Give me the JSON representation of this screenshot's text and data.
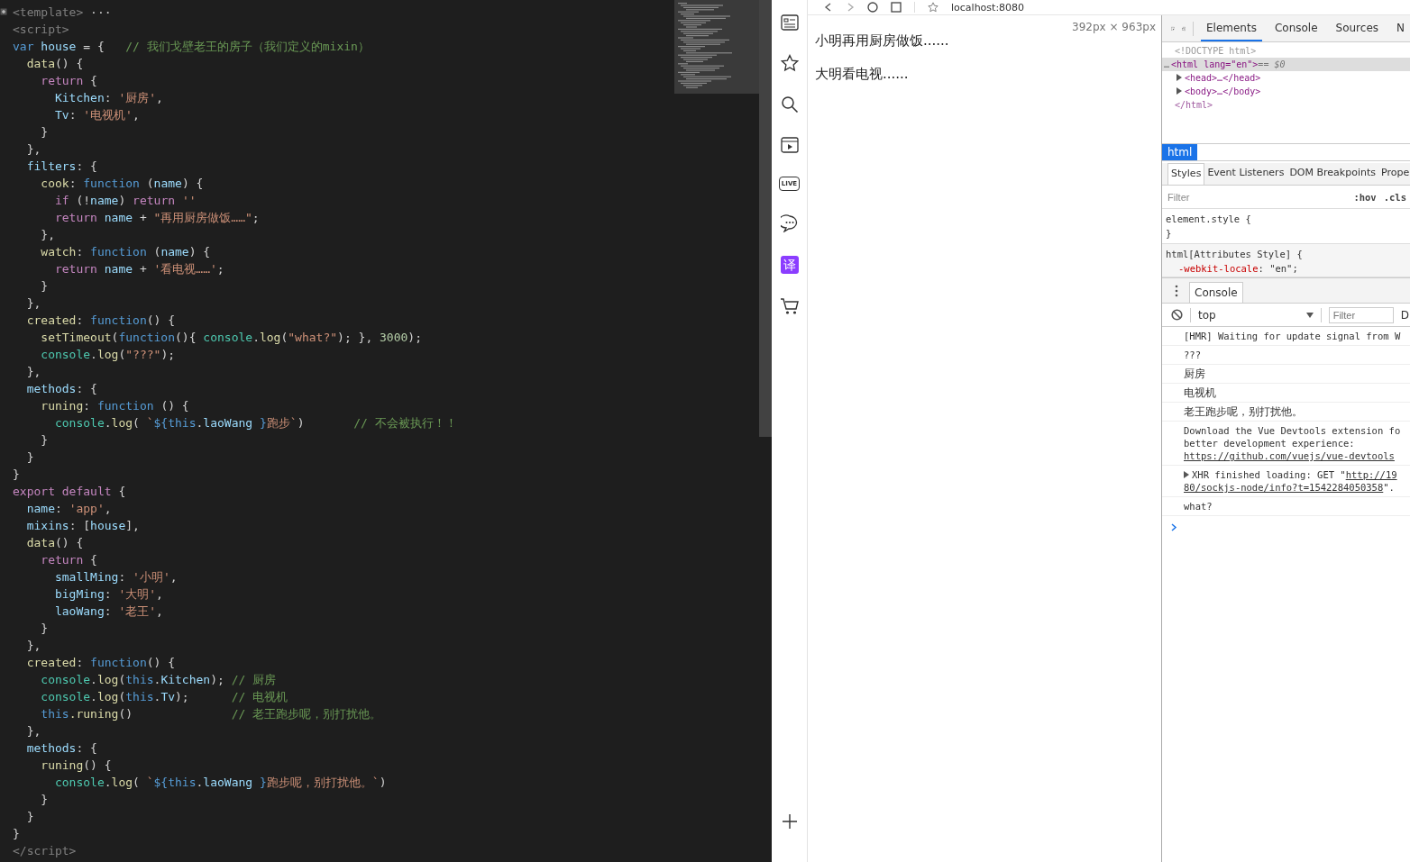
{
  "editor": {
    "lines": [
      {
        "tokens": [
          {
            "kind": "tag",
            "text": "<template>"
          },
          {
            "kind": "plain",
            "text": " ···"
          }
        ]
      },
      {
        "tokens": [
          {
            "kind": "tag",
            "text": "<script>"
          }
        ]
      },
      {
        "tokens": [
          {
            "kind": "storage",
            "text": "var "
          },
          {
            "kind": "variable",
            "text": "house"
          },
          {
            "kind": "plain",
            "text": " = {   "
          },
          {
            "kind": "comment",
            "text": "// 我们戈壁老王的房子（我们定义的mixin）"
          }
        ]
      },
      {
        "tokens": [
          {
            "kind": "function",
            "text": "  data"
          },
          {
            "kind": "plain",
            "text": "() {"
          }
        ]
      },
      {
        "tokens": [
          {
            "kind": "keyword",
            "text": "    return"
          },
          {
            "kind": "plain",
            "text": " {"
          }
        ]
      },
      {
        "tokens": [
          {
            "kind": "variable",
            "text": "      Kitchen"
          },
          {
            "kind": "plain",
            "text": ": "
          },
          {
            "kind": "string",
            "text": "'厨房'"
          },
          {
            "kind": "plain",
            "text": ","
          }
        ]
      },
      {
        "tokens": [
          {
            "kind": "variable",
            "text": "      Tv"
          },
          {
            "kind": "plain",
            "text": ": "
          },
          {
            "kind": "string",
            "text": "'电视机'"
          },
          {
            "kind": "plain",
            "text": ","
          }
        ]
      },
      {
        "tokens": [
          {
            "kind": "plain",
            "text": "    }"
          }
        ]
      },
      {
        "tokens": [
          {
            "kind": "plain",
            "text": "  },"
          }
        ]
      },
      {
        "tokens": [
          {
            "kind": "variable",
            "text": "  filters"
          },
          {
            "kind": "plain",
            "text": ": {"
          }
        ]
      },
      {
        "tokens": [
          {
            "kind": "function",
            "text": "    cook"
          },
          {
            "kind": "plain",
            "text": ": "
          },
          {
            "kind": "storage",
            "text": "function"
          },
          {
            "kind": "plain",
            "text": " ("
          },
          {
            "kind": "variable",
            "text": "name"
          },
          {
            "kind": "plain",
            "text": ") {"
          }
        ]
      },
      {
        "tokens": [
          {
            "kind": "keyword",
            "text": "      if"
          },
          {
            "kind": "plain",
            "text": " (!"
          },
          {
            "kind": "variable",
            "text": "name"
          },
          {
            "kind": "plain",
            "text": ") "
          },
          {
            "kind": "keyword",
            "text": "return "
          },
          {
            "kind": "string",
            "text": "''"
          }
        ]
      },
      {
        "tokens": [
          {
            "kind": "keyword",
            "text": "      return "
          },
          {
            "kind": "variable",
            "text": "name"
          },
          {
            "kind": "plain",
            "text": " + "
          },
          {
            "kind": "string",
            "text": "\"再用厨房做饭……\""
          },
          {
            "kind": "plain",
            "text": ";"
          }
        ]
      },
      {
        "tokens": [
          {
            "kind": "plain",
            "text": "    },"
          }
        ]
      },
      {
        "tokens": [
          {
            "kind": "function",
            "text": "    watch"
          },
          {
            "kind": "plain",
            "text": ": "
          },
          {
            "kind": "storage",
            "text": "function"
          },
          {
            "kind": "plain",
            "text": " ("
          },
          {
            "kind": "variable",
            "text": "name"
          },
          {
            "kind": "plain",
            "text": ") {"
          }
        ]
      },
      {
        "tokens": [
          {
            "kind": "keyword",
            "text": "      return "
          },
          {
            "kind": "variable",
            "text": "name"
          },
          {
            "kind": "plain",
            "text": " + "
          },
          {
            "kind": "string",
            "text": "'看电视……'"
          },
          {
            "kind": "plain",
            "text": ";"
          }
        ]
      },
      {
        "tokens": [
          {
            "kind": "plain",
            "text": "    }"
          }
        ]
      },
      {
        "tokens": [
          {
            "kind": "plain",
            "text": "  },"
          }
        ]
      },
      {
        "tokens": [
          {
            "kind": "function",
            "text": "  created"
          },
          {
            "kind": "plain",
            "text": ": "
          },
          {
            "kind": "storage",
            "text": "function"
          },
          {
            "kind": "plain",
            "text": "() {"
          }
        ]
      },
      {
        "tokens": [
          {
            "kind": "function",
            "text": "    setTimeout"
          },
          {
            "kind": "plain",
            "text": "("
          },
          {
            "kind": "storage",
            "text": "function"
          },
          {
            "kind": "plain",
            "text": "(){ "
          },
          {
            "kind": "object",
            "text": "console"
          },
          {
            "kind": "plain",
            "text": "."
          },
          {
            "kind": "function",
            "text": "log"
          },
          {
            "kind": "plain",
            "text": "("
          },
          {
            "kind": "string",
            "text": "\"what?\""
          },
          {
            "kind": "plain",
            "text": "); }, "
          },
          {
            "kind": "number",
            "text": "3000"
          },
          {
            "kind": "plain",
            "text": ");"
          }
        ]
      },
      {
        "tokens": [
          {
            "kind": "object",
            "text": "    console"
          },
          {
            "kind": "plain",
            "text": "."
          },
          {
            "kind": "function",
            "text": "log"
          },
          {
            "kind": "plain",
            "text": "("
          },
          {
            "kind": "string",
            "text": "\"???\""
          },
          {
            "kind": "plain",
            "text": ");"
          }
        ]
      },
      {
        "tokens": [
          {
            "kind": "plain",
            "text": "  },"
          }
        ]
      },
      {
        "tokens": [
          {
            "kind": "variable",
            "text": "  methods"
          },
          {
            "kind": "plain",
            "text": ": {"
          }
        ]
      },
      {
        "tokens": [
          {
            "kind": "function",
            "text": "    runing"
          },
          {
            "kind": "plain",
            "text": ": "
          },
          {
            "kind": "storage",
            "text": "function"
          },
          {
            "kind": "plain",
            "text": " () {"
          }
        ]
      },
      {
        "tokens": [
          {
            "kind": "object",
            "text": "      console"
          },
          {
            "kind": "plain",
            "text": "."
          },
          {
            "kind": "function",
            "text": "log"
          },
          {
            "kind": "plain",
            "text": "( "
          },
          {
            "kind": "string",
            "text": "`"
          },
          {
            "kind": "storage",
            "text": "${this"
          },
          {
            "kind": "plain",
            "text": "."
          },
          {
            "kind": "variable",
            "text": "laoWang"
          },
          {
            "kind": "storage",
            "text": " }"
          },
          {
            "kind": "string",
            "text": "跑步`"
          },
          {
            "kind": "plain",
            "text": ")       "
          },
          {
            "kind": "comment",
            "text": "// 不会被执行！！"
          }
        ]
      },
      {
        "tokens": [
          {
            "kind": "plain",
            "text": "    }"
          }
        ]
      },
      {
        "tokens": [
          {
            "kind": "plain",
            "text": "  }"
          }
        ]
      },
      {
        "tokens": [
          {
            "kind": "plain",
            "text": "}"
          }
        ]
      },
      {
        "tokens": [
          {
            "kind": "keyword",
            "text": "export default"
          },
          {
            "kind": "plain",
            "text": " {"
          }
        ]
      },
      {
        "tokens": [
          {
            "kind": "variable",
            "text": "  name"
          },
          {
            "kind": "plain",
            "text": ": "
          },
          {
            "kind": "string",
            "text": "'app'"
          },
          {
            "kind": "plain",
            "text": ","
          }
        ]
      },
      {
        "tokens": [
          {
            "kind": "variable",
            "text": "  mixins"
          },
          {
            "kind": "plain",
            "text": ": ["
          },
          {
            "kind": "variable",
            "text": "house"
          },
          {
            "kind": "plain",
            "text": "],"
          }
        ]
      },
      {
        "tokens": [
          {
            "kind": "function",
            "text": "  data"
          },
          {
            "kind": "plain",
            "text": "() {"
          }
        ]
      },
      {
        "tokens": [
          {
            "kind": "keyword",
            "text": "    return"
          },
          {
            "kind": "plain",
            "text": " {"
          }
        ]
      },
      {
        "tokens": [
          {
            "kind": "variable",
            "text": "      smallMing"
          },
          {
            "kind": "plain",
            "text": ": "
          },
          {
            "kind": "string",
            "text": "'小明'"
          },
          {
            "kind": "plain",
            "text": ","
          }
        ]
      },
      {
        "tokens": [
          {
            "kind": "variable",
            "text": "      bigMing"
          },
          {
            "kind": "plain",
            "text": ": "
          },
          {
            "kind": "string",
            "text": "'大明'"
          },
          {
            "kind": "plain",
            "text": ","
          }
        ]
      },
      {
        "tokens": [
          {
            "kind": "variable",
            "text": "      laoWang"
          },
          {
            "kind": "plain",
            "text": ": "
          },
          {
            "kind": "string",
            "text": "'老王'"
          },
          {
            "kind": "plain",
            "text": ","
          }
        ]
      },
      {
        "tokens": [
          {
            "kind": "plain",
            "text": "    }"
          }
        ]
      },
      {
        "tokens": [
          {
            "kind": "plain",
            "text": "  },"
          }
        ]
      },
      {
        "tokens": [
          {
            "kind": "function",
            "text": "  created"
          },
          {
            "kind": "plain",
            "text": ": "
          },
          {
            "kind": "storage",
            "text": "function"
          },
          {
            "kind": "plain",
            "text": "() {"
          }
        ]
      },
      {
        "tokens": [
          {
            "kind": "object",
            "text": "    console"
          },
          {
            "kind": "plain",
            "text": "."
          },
          {
            "kind": "function",
            "text": "log"
          },
          {
            "kind": "plain",
            "text": "("
          },
          {
            "kind": "storage",
            "text": "this"
          },
          {
            "kind": "plain",
            "text": "."
          },
          {
            "kind": "variable",
            "text": "Kitchen"
          },
          {
            "kind": "plain",
            "text": "); "
          },
          {
            "kind": "comment",
            "text": "// 厨房"
          }
        ]
      },
      {
        "tokens": [
          {
            "kind": "object",
            "text": "    console"
          },
          {
            "kind": "plain",
            "text": "."
          },
          {
            "kind": "function",
            "text": "log"
          },
          {
            "kind": "plain",
            "text": "("
          },
          {
            "kind": "storage",
            "text": "this"
          },
          {
            "kind": "plain",
            "text": "."
          },
          {
            "kind": "variable",
            "text": "Tv"
          },
          {
            "kind": "plain",
            "text": ");      "
          },
          {
            "kind": "comment",
            "text": "// 电视机"
          }
        ]
      },
      {
        "tokens": [
          {
            "kind": "storage",
            "text": "    this"
          },
          {
            "kind": "function",
            "text": ".runing"
          },
          {
            "kind": "plain",
            "text": "()              "
          },
          {
            "kind": "comment",
            "text": "// 老王跑步呢，别打扰他。"
          }
        ]
      },
      {
        "tokens": [
          {
            "kind": "plain",
            "text": "  },"
          }
        ]
      },
      {
        "tokens": [
          {
            "kind": "variable",
            "text": "  methods"
          },
          {
            "kind": "plain",
            "text": ": {"
          }
        ]
      },
      {
        "tokens": [
          {
            "kind": "function",
            "text": "    runing"
          },
          {
            "kind": "plain",
            "text": "() {"
          }
        ]
      },
      {
        "tokens": [
          {
            "kind": "object",
            "text": "      console"
          },
          {
            "kind": "plain",
            "text": "."
          },
          {
            "kind": "function",
            "text": "log"
          },
          {
            "kind": "plain",
            "text": "( "
          },
          {
            "kind": "string",
            "text": "`"
          },
          {
            "kind": "storage",
            "text": "${this"
          },
          {
            "kind": "plain",
            "text": "."
          },
          {
            "kind": "variable",
            "text": "laoWang"
          },
          {
            "kind": "storage",
            "text": " }"
          },
          {
            "kind": "string",
            "text": "跑步呢，别打扰他。`"
          },
          {
            "kind": "plain",
            "text": ")"
          }
        ]
      },
      {
        "tokens": [
          {
            "kind": "plain",
            "text": "    }"
          }
        ]
      },
      {
        "tokens": [
          {
            "kind": "plain",
            "text": "  }"
          }
        ]
      },
      {
        "tokens": [
          {
            "kind": "plain",
            "text": "}"
          }
        ]
      },
      {
        "tokens": [
          {
            "kind": "tag",
            "text": "</script>"
          }
        ]
      }
    ]
  },
  "sidebar": {
    "live_label": "LIVE",
    "translate_label": "译"
  },
  "browser": {
    "url": "localhost:8080",
    "viewport_size": "392px  ×  963px",
    "page_lines": [
      "小明再用厨房做饭......",
      "大明看电视......"
    ]
  },
  "devtools": {
    "tabs": [
      {
        "label": "Elements",
        "selected": true
      },
      {
        "label": "Console",
        "selected": false
      },
      {
        "label": "Sources",
        "selected": false
      },
      {
        "label": "N",
        "selected": false
      }
    ],
    "tree": [
      {
        "kind": "doctype",
        "text": "<!DOCTYPE html>",
        "selected": false
      },
      {
        "kind": "element",
        "gutter": "…",
        "text": "<html lang=\"en\">",
        "suffix": "== $0",
        "selected": true,
        "children": [
          {
            "kind": "collapsed",
            "text": "<head>…</head>",
            "selected": false
          },
          {
            "kind": "collapsed",
            "text": "<body>…</body>",
            "selected": false
          }
        ]
      },
      {
        "kind": "close",
        "text": "</html>",
        "selected": false
      }
    ],
    "breadcrumbs": [
      {
        "label": "html",
        "selected": true
      }
    ],
    "style_tabs": [
      {
        "label": "Styles",
        "selected": true
      },
      {
        "label": "Event Listeners",
        "selected": false
      },
      {
        "label": "DOM Breakpoints",
        "selected": false
      },
      {
        "label": "Prope",
        "selected": false
      }
    ],
    "styles_filter": {
      "placeholder": "Filter",
      "hov": ":hov",
      "cls": ".cls"
    },
    "rules": [
      {
        "selector": "element.style {",
        "close": "}"
      },
      {
        "selector": "html[Attributes Style] {",
        "declarations": [
          {
            "property": "-webkit-locale",
            "value": ": \"en\";"
          }
        ]
      }
    ],
    "drawer_tabs": [
      {
        "label": "Console",
        "selected": true
      }
    ],
    "console_toolbar": {
      "context": "top",
      "filter_placeholder": "Filter",
      "cut_label": "D"
    },
    "messages": [
      {
        "kind": "mono",
        "expandable": false,
        "lines": [
          [
            {
              "text": "[HMR] Waiting for update signal from W",
              "link": false
            }
          ]
        ]
      },
      {
        "kind": "mono",
        "expandable": false,
        "lines": [
          [
            {
              "text": "???",
              "link": false
            }
          ]
        ]
      },
      {
        "kind": "text",
        "expandable": false,
        "lines": [
          [
            {
              "text": "厨房",
              "link": false
            }
          ]
        ]
      },
      {
        "kind": "text",
        "expandable": false,
        "lines": [
          [
            {
              "text": "电视机",
              "link": false
            }
          ]
        ]
      },
      {
        "kind": "text",
        "expandable": false,
        "lines": [
          [
            {
              "text": "老王跑步呢，别打扰他。",
              "link": false
            }
          ]
        ]
      },
      {
        "kind": "mono",
        "expandable": false,
        "lines": [
          [
            {
              "text": "Download the Vue Devtools extension fo",
              "link": false
            }
          ],
          [
            {
              "text": "better development experience:",
              "link": false
            }
          ],
          [
            {
              "text": "https://github.com/vuejs/vue-devtools",
              "link": true
            }
          ]
        ]
      },
      {
        "kind": "mono",
        "expandable": true,
        "lines": [
          [
            {
              "text": "XHR finished loading: GET \"",
              "link": false
            },
            {
              "text": "http://19",
              "link": true
            }
          ],
          [
            {
              "text": "80/sockjs-node/info?t=1542284050358",
              "link": true
            },
            {
              "text": "\".",
              "link": false
            }
          ]
        ]
      },
      {
        "kind": "mono",
        "expandable": false,
        "lines": [
          [
            {
              "text": "what?",
              "link": false
            }
          ]
        ]
      }
    ]
  }
}
